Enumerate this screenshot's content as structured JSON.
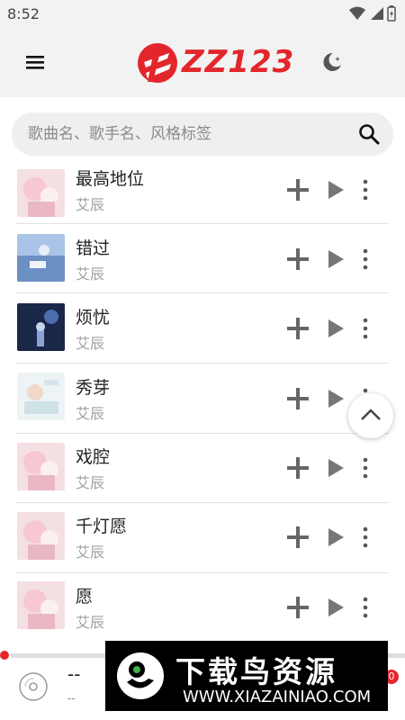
{
  "status_bar": {
    "time": "8:52"
  },
  "header": {
    "logo_text": "ZZ123"
  },
  "search": {
    "placeholder": "歌曲名、歌手名、风格标签"
  },
  "songs": [
    {
      "title": "最高地位",
      "artist": "艾辰"
    },
    {
      "title": "错过",
      "artist": "艾辰"
    },
    {
      "title": "烦忧",
      "artist": "艾辰"
    },
    {
      "title": "秀芽",
      "artist": "艾辰"
    },
    {
      "title": "戏腔",
      "artist": "艾辰"
    },
    {
      "title": "千灯愿",
      "artist": "艾辰"
    },
    {
      "title": "愿",
      "artist": "艾辰"
    }
  ],
  "player": {
    "title": "--",
    "artist": "--",
    "queue_count": "0"
  },
  "watermark": {
    "title": "下载鸟资源",
    "url": "WWW.XIAZAINIAO.COM"
  },
  "colors": {
    "accent": "#e3262b",
    "header_bg": "#f2f2f2"
  }
}
